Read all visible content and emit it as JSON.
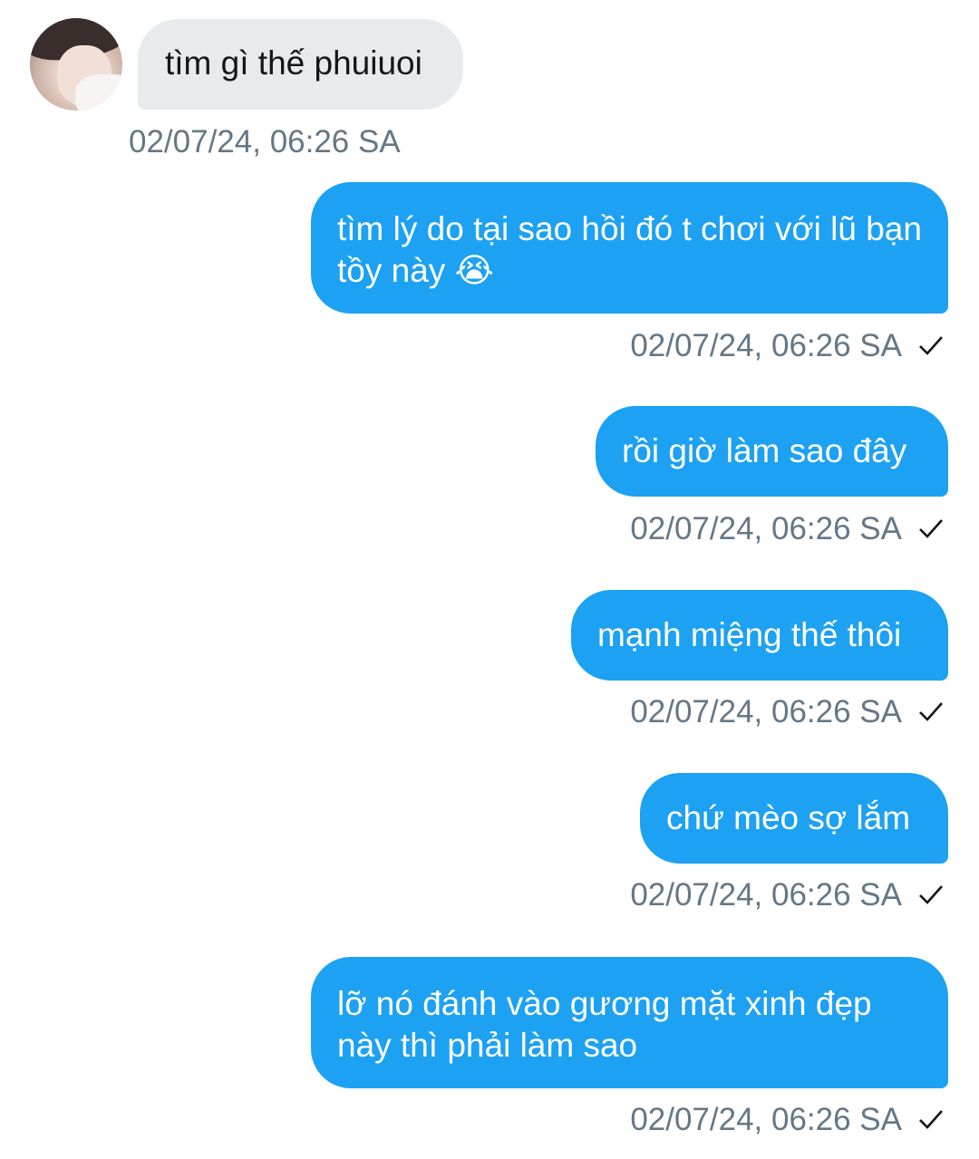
{
  "conversation": {
    "incoming": [
      {
        "text": "tìm gì thế phuiuoi",
        "timestamp": "02/07/24, 06:26 SA"
      }
    ],
    "outgoing": [
      {
        "text": "tìm lý do tại sao hồi đó t chơi với lũ bạn tồy này 😭",
        "timestamp": "02/07/24, 06:26 SA",
        "status": "check-icon"
      },
      {
        "text": "rồi giờ làm sao đây",
        "timestamp": "02/07/24, 06:26 SA",
        "status": "check-icon"
      },
      {
        "text": "mạnh miệng thế thôi",
        "timestamp": "02/07/24, 06:26 SA",
        "status": "check-icon"
      },
      {
        "text": "chứ mèo sợ lắm",
        "timestamp": "02/07/24, 06:26 SA",
        "status": "check-icon"
      },
      {
        "text": "lỡ nó đánh vào gương mặt xinh đẹp này thì phải làm sao",
        "timestamp": "02/07/24, 06:26 SA",
        "status": "check-icon"
      }
    ]
  },
  "colors": {
    "outgoing_bubble": "#1da1f2",
    "incoming_bubble": "#e7ebee",
    "timestamp_text": "#657786"
  }
}
